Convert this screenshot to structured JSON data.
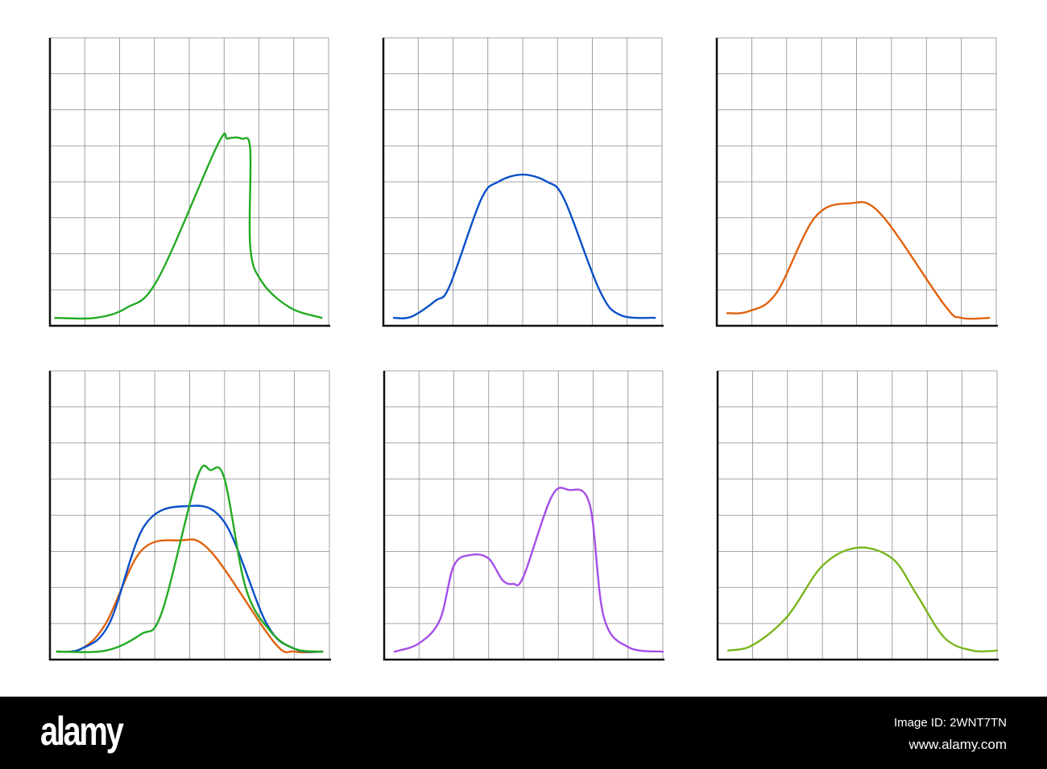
{
  "chart_data": [
    {
      "type": "line",
      "title": "",
      "grid": true,
      "xlim": [
        0,
        8
      ],
      "ylim": [
        0,
        8
      ],
      "series": [
        {
          "name": "green",
          "color": "#22aa22",
          "points": [
            [
              0.15,
              0.22
            ],
            [
              1.3,
              0.22
            ],
            [
              2.2,
              0.5
            ],
            [
              3.1,
              1.3
            ],
            [
              4.8,
              5.0
            ],
            [
              5.1,
              5.2
            ],
            [
              5.5,
              5.2
            ],
            [
              5.75,
              4.9
            ],
            [
              5.75,
              2.2
            ],
            [
              6.1,
              1.2
            ],
            [
              6.9,
              0.5
            ],
            [
              7.8,
              0.22
            ]
          ]
        }
      ]
    },
    {
      "type": "line",
      "title": "",
      "grid": true,
      "xlim": [
        0,
        8
      ],
      "ylim": [
        0,
        8
      ],
      "series": [
        {
          "name": "blue",
          "color": "#0a50c8",
          "points": [
            [
              0.3,
              0.22
            ],
            [
              0.8,
              0.25
            ],
            [
              1.5,
              0.7
            ],
            [
              1.9,
              1.1
            ],
            [
              2.8,
              3.5
            ],
            [
              3.3,
              4.0
            ],
            [
              4.0,
              4.2
            ],
            [
              4.7,
              4.0
            ],
            [
              5.2,
              3.5
            ],
            [
              6.2,
              1.0
            ],
            [
              6.8,
              0.3
            ],
            [
              7.8,
              0.22
            ]
          ]
        }
      ]
    },
    {
      "type": "line",
      "title": "",
      "grid": true,
      "xlim": [
        0,
        8
      ],
      "ylim": [
        0,
        8
      ],
      "series": [
        {
          "name": "orange",
          "color": "#e0620f",
          "points": [
            [
              0.3,
              0.35
            ],
            [
              0.9,
              0.4
            ],
            [
              1.7,
              0.9
            ],
            [
              2.8,
              3.0
            ],
            [
              3.8,
              3.4
            ],
            [
              4.7,
              3.1
            ],
            [
              6.5,
              0.6
            ],
            [
              7.0,
              0.22
            ],
            [
              7.8,
              0.22
            ]
          ]
        }
      ]
    },
    {
      "type": "line",
      "title": "",
      "grid": true,
      "xlim": [
        0,
        8
      ],
      "ylim": [
        0,
        8
      ],
      "series": [
        {
          "name": "orange",
          "color": "#e0620f",
          "points": [
            [
              0.2,
              0.22
            ],
            [
              0.9,
              0.3
            ],
            [
              1.6,
              1.0
            ],
            [
              2.6,
              3.0
            ],
            [
              3.7,
              3.3
            ],
            [
              4.6,
              3.0
            ],
            [
              6.4,
              0.5
            ],
            [
              7.0,
              0.22
            ],
            [
              7.8,
              0.22
            ]
          ]
        },
        {
          "name": "blue",
          "color": "#0a50c8",
          "points": [
            [
              0.2,
              0.22
            ],
            [
              0.9,
              0.3
            ],
            [
              1.7,
              1.0
            ],
            [
              2.7,
              3.7
            ],
            [
              3.9,
              4.25
            ],
            [
              5.0,
              3.8
            ],
            [
              6.2,
              1.0
            ],
            [
              7.0,
              0.3
            ],
            [
              7.8,
              0.22
            ]
          ]
        },
        {
          "name": "green",
          "color": "#22aa22",
          "points": [
            [
              0.2,
              0.22
            ],
            [
              1.6,
              0.25
            ],
            [
              2.6,
              0.7
            ],
            [
              3.2,
              1.3
            ],
            [
              4.2,
              5.0
            ],
            [
              4.6,
              5.25
            ],
            [
              5.0,
              5.0
            ],
            [
              5.6,
              2.0
            ],
            [
              6.3,
              0.8
            ],
            [
              7.0,
              0.3
            ],
            [
              7.8,
              0.22
            ]
          ]
        }
      ]
    },
    {
      "type": "line",
      "title": "",
      "grid": true,
      "xlim": [
        0,
        8
      ],
      "ylim": [
        0,
        8
      ],
      "series": [
        {
          "name": "purple",
          "color": "#a64ee8",
          "points": [
            [
              0.3,
              0.22
            ],
            [
              1.0,
              0.45
            ],
            [
              1.6,
              1.1
            ],
            [
              2.0,
              2.6
            ],
            [
              2.5,
              2.9
            ],
            [
              3.0,
              2.8
            ],
            [
              3.4,
              2.2
            ],
            [
              3.7,
              2.1
            ],
            [
              4.0,
              2.3
            ],
            [
              4.8,
              4.5
            ],
            [
              5.3,
              4.7
            ],
            [
              5.9,
              4.3
            ],
            [
              6.3,
              1.2
            ],
            [
              7.0,
              0.35
            ],
            [
              8.0,
              0.22
            ]
          ]
        }
      ]
    },
    {
      "type": "line",
      "title": "",
      "grid": true,
      "xlim": [
        0,
        8
      ],
      "ylim": [
        0,
        8
      ],
      "series": [
        {
          "name": "lime",
          "color": "#7ab51d",
          "points": [
            [
              0.3,
              0.25
            ],
            [
              1.0,
              0.4
            ],
            [
              2.0,
              1.2
            ],
            [
              3.0,
              2.6
            ],
            [
              4.0,
              3.1
            ],
            [
              5.0,
              2.8
            ],
            [
              5.7,
              1.8
            ],
            [
              6.5,
              0.6
            ],
            [
              7.3,
              0.25
            ],
            [
              8.0,
              0.25
            ]
          ]
        }
      ]
    }
  ],
  "footer": {
    "logo": "alamy",
    "image_id": "Image ID: 2WNT7TN",
    "site": "www.alamy.com"
  }
}
